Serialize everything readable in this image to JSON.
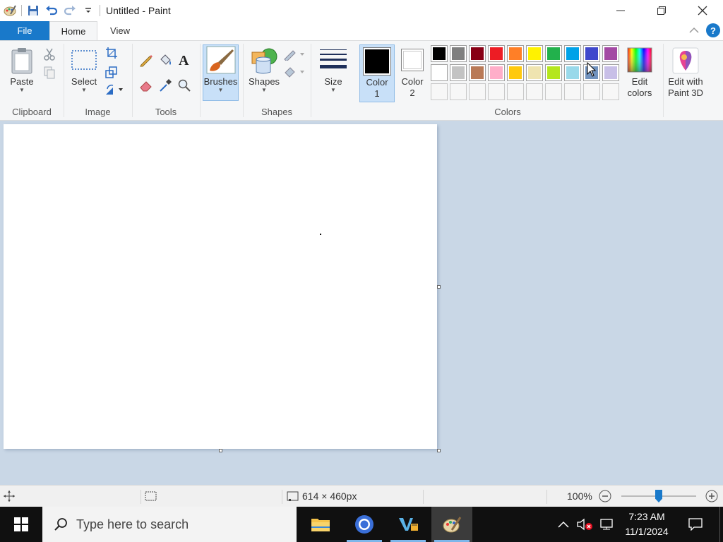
{
  "window": {
    "title": "Untitled - Paint"
  },
  "tabs": {
    "file": "File",
    "home": "Home",
    "view": "View"
  },
  "ribbon": {
    "clipboard": {
      "paste": "Paste",
      "group_label": "Clipboard"
    },
    "image": {
      "select": "Select",
      "group_label": "Image"
    },
    "tools": {
      "group_label": "Tools"
    },
    "brushes": {
      "label": "Brushes"
    },
    "shapes": {
      "label": "Shapes",
      "group_label": "Shapes"
    },
    "size": {
      "label": "Size"
    },
    "color1": {
      "label_line1": "Color",
      "label_line2": "1",
      "value": "#000000"
    },
    "color2": {
      "label_line1": "Color",
      "label_line2": "2",
      "value": "#ffffff"
    },
    "colors": {
      "group_label": "Colors",
      "row1": [
        "#000000",
        "#7f7f7f",
        "#880015",
        "#ed1c24",
        "#ff7f27",
        "#fff200",
        "#22b14c",
        "#00a2e8",
        "#3f48cc",
        "#a349a4"
      ],
      "row2": [
        "#ffffff",
        "#c3c3c3",
        "#b97a57",
        "#ffaec9",
        "#ffc90e",
        "#efe4b0",
        "#b5e61d",
        "#99d9ea",
        "#7092be",
        "#c8bfe7"
      ],
      "row3_count": 10
    },
    "edit_colors": {
      "line1": "Edit",
      "line2": "colors"
    },
    "edit_paint3d": {
      "line1": "Edit with",
      "line2": "Paint 3D"
    }
  },
  "status": {
    "dimensions": "614 × 460px",
    "zoom": "100%",
    "zoom_fraction": 0.5
  },
  "taskbar": {
    "search_placeholder": "Type here to search",
    "time": "7:23 AM",
    "date": "11/1/2024"
  }
}
